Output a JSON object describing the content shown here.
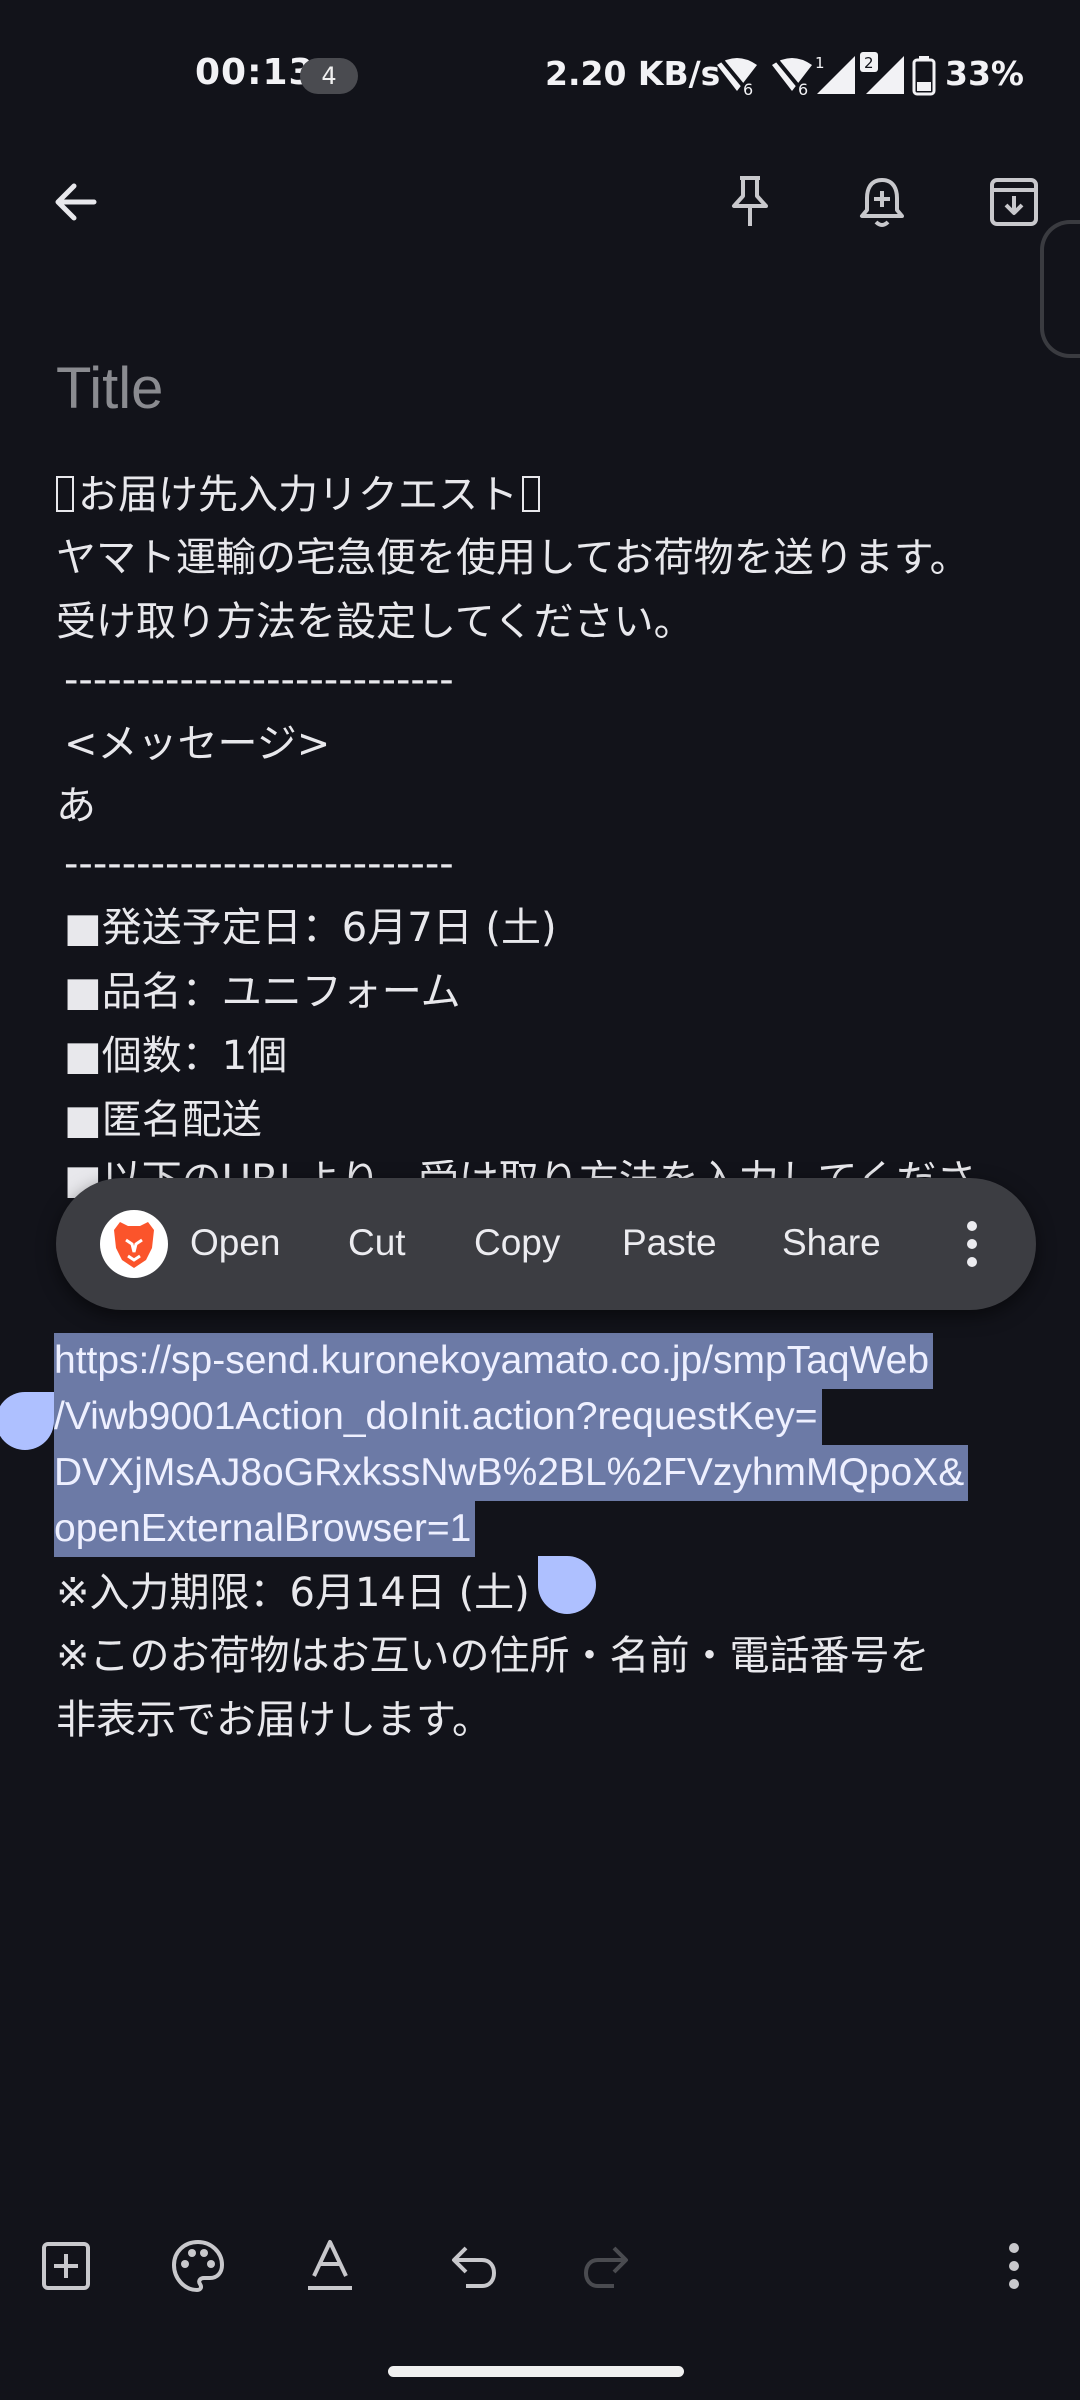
{
  "status_bar": {
    "time": "00:13",
    "notification_count": "4",
    "net_speed": "2.20 KB/s",
    "battery": "33%"
  },
  "toolbar": {
    "back_icon": "arrow-left-icon",
    "pin_icon": "pin-icon",
    "reminder_icon": "bell-plus-icon",
    "archive_icon": "archive-icon"
  },
  "note": {
    "title_placeholder": "Title",
    "lines": [
      "お届け先入力リクエスト",
      "ヤマト運輸の宅急便を使用してお荷物を送ります。",
      "受け取り方法を設定してください。",
      "---------------------------",
      "<メッセージ>",
      "あ",
      "---------------------------",
      "■発送予定日：6月7日 (土)",
      "■品名：ユニフォーム",
      "■個数：1個",
      "■匿名配送",
      "■以下のURLより、受け取り方法を入力してくださ"
    ],
    "url_lines": [
      "https://sp-send.kuronekoyamato.co.jp/smpTaqWeb",
      "/Viwb9001Action_doInit.action?requestKey=",
      "DVXjMsAJ8oGRxkssNwB%2BL%2FVzyhmMQpoX&",
      "openExternalBrowser=1"
    ],
    "after_lines": [
      "※入力期限：6月14日 (土)",
      "※このお荷物はお互いの住所・名前・電話番号を",
      "非表示でお届けします。"
    ]
  },
  "context_menu": {
    "open": "Open",
    "cut": "Cut",
    "copy": "Copy",
    "paste": "Paste",
    "share": "Share"
  },
  "colors": {
    "background": "#12131a",
    "selection": "#6c7aa6",
    "handle": "#aec0ff",
    "menu": "#3c3d42"
  }
}
